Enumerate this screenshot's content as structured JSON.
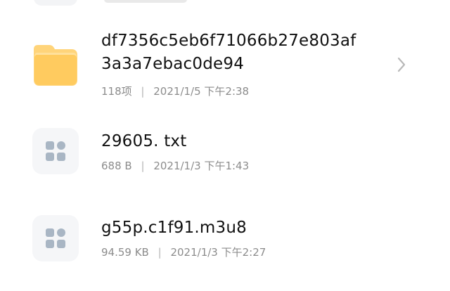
{
  "files": [
    {
      "name_line1": "df7356c5eb6f71066b27e803af",
      "name_line2": "3a3a7ebac0de94",
      "count": "118项",
      "date": "2021/1/5 下午2:38",
      "type_icon": "folder-icon"
    },
    {
      "name": "29605. txt",
      "size": "688 B",
      "date": "2021/1/3 下午1:43",
      "type_icon": "file-grid-icon"
    },
    {
      "name": "g55p.c1f91.m3u8",
      "size": "94.59 KB",
      "date": "2021/1/3 下午2:27",
      "type_icon": "file-grid-icon"
    }
  ],
  "separator": "|",
  "colors": {
    "folder": "#ffd47a",
    "file_thumb_bg": "#f5f6f8",
    "file_icon": "#a9b6c4",
    "name_text": "#111111",
    "meta_text": "#8c8c8c",
    "chevron": "#b8b8b8"
  }
}
